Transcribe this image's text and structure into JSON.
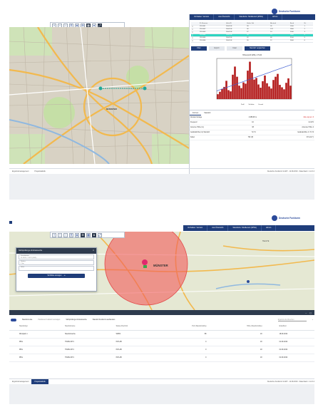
{
  "brand": {
    "name": "Deutsche Funkturm"
  },
  "screen1": {
    "nav": [
      "Vorhaben: Version",
      "Aus Übersicht",
      "Standorte: Straßenort (WSG)",
      "Admin"
    ],
    "table_headers": [
      "",
      "ID-Nummer",
      "Höhe/ID",
      "Hoher Std",
      "Abstand",
      "Band",
      "Nr."
    ],
    "table_rows": [
      [
        "☐",
        "2116501",
        "2004 DE",
        "38",
        "26",
        "1500",
        "1"
      ],
      [
        "☐",
        "2116502",
        "2004 DE",
        "36",
        "178",
        "1800",
        "2"
      ],
      [
        "☐",
        "2116503",
        "2004 DE",
        "37",
        "14",
        "2000",
        "3"
      ],
      [
        "☑",
        "2116504",
        "2004 DE",
        "34",
        "73",
        "1800",
        "4"
      ],
      [
        "☐",
        "2116505",
        "2004 DE",
        "32",
        "68",
        "2100",
        "5"
      ],
      [
        "☐",
        "2116506",
        "2004 DE",
        "30",
        "12",
        "2600",
        "6"
      ]
    ],
    "buttons": [
      "Filter",
      "Export",
      "Clear",
      "Standort vergleichen"
    ],
    "chart_data": {
      "type": "bar",
      "title": "Höhenprofil (MSL) / Profil",
      "series": [
        {
          "values": [
            12,
            18,
            25,
            30,
            45,
            22,
            19,
            60,
            80,
            55,
            33,
            27,
            41,
            38,
            70,
            92,
            65,
            48,
            52,
            36,
            28,
            44,
            58,
            39,
            31,
            26,
            47,
            55,
            62,
            35,
            29,
            24,
            40,
            51,
            33
          ]
        }
      ],
      "line_series": [
        20,
        85
      ],
      "legend": [
        "Profil",
        "Sichtlinie",
        "Fresnel"
      ]
    },
    "tabs": [
      "Formen",
      "Standort"
    ],
    "form_rows": [
      {
        "label": "Abstand Anlage",
        "value": "1.688,08 m",
        "extra": "Ziel engt an: 6"
      },
      {
        "label": "Frequenz",
        "value": "10",
        "extra": "11 GHz"
      },
      {
        "label": "Antenne Höhe (m)",
        "value": "38",
        "extra": "Antenne Höhe 2"
      },
      {
        "label": "Geländehöhe (m) Standort",
        "value": "72,74",
        "extra": "Geländehöhe 2: 72,74"
      },
      {
        "label": "Kabel",
        "value": "752 (P)",
        "extra": "372,24 (*)"
      }
    ],
    "status_tabs": [
      "Ergebnismanagement",
      "Projektstatistik"
    ],
    "status_right": "Deutsche Funkturm GmbH  ·  12.09.2019  ·  Datenbank: 1 v2.3.4",
    "map_label": "MÜNSTER"
  },
  "screen2": {
    "nav": [
      "Vorhaben: Version",
      "Aus Übersicht",
      "Standorte: Straßenort (WSG)",
      "Admin"
    ],
    "map_label": "MÜNSTER",
    "map_label_2": "TELGTE",
    "dialog": {
      "title": "Sichtprüfungs-Umkreissuche",
      "field1_label": "Koordinaten",
      "field1_value": "51.9624, 7.6257 (KML)",
      "field2_label": "Radius",
      "field2_value": "5 km",
      "field3_label": "Höhe",
      "button": "Sichtlinie anzeigen"
    },
    "toolbar_labels": [
      "Standort-Liste",
      "Positionen Funkturm anzeigen",
      "Sichtprüfungs-Umkreissuche",
      "Standort Funkturm ausblenden"
    ],
    "search_placeholder": "Ergebnis durchsuchen",
    "table_headers": [
      "Standorttyp",
      "Standortname",
      "Status Abschnitt",
      "PLZ (Standortnähe)",
      "Höhe (Standortnähe)",
      "Erstellzeit"
    ],
    "table_rows": [
      [
        "Windpark 1",
        "Standortsuche",
        "WPPA",
        "88",
        "18",
        "18.09.2019"
      ],
      [
        "PRG",
        "TOWE 2074",
        "INTLAB",
        "0",
        "18",
        "01.09.2019"
      ],
      [
        "PRG",
        "TOWE 2074",
        "INTLAB",
        "0",
        "18",
        "01.09.2019"
      ],
      [
        "PRG",
        "TOWE 2074",
        "INTLAB",
        "0",
        "18",
        "01.09.2019"
      ]
    ],
    "status_tabs": [
      "Ergebnismanagement",
      "Projektstatistik"
    ],
    "status_right": "Deutsche Funkturm GmbH  ·  12.09.2019  ·  Datenbank: 1 v2.3.4"
  }
}
